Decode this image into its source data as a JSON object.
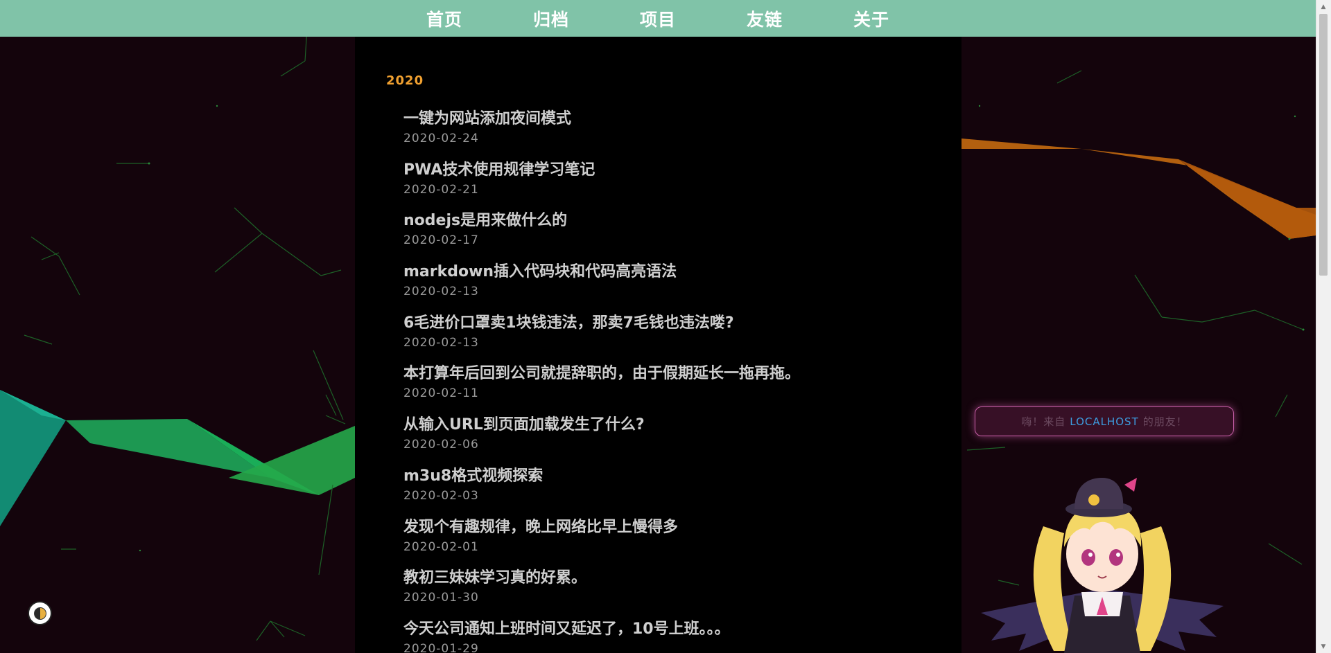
{
  "nav": {
    "items": [
      {
        "label": "首页"
      },
      {
        "label": "归档"
      },
      {
        "label": "项目"
      },
      {
        "label": "友链"
      },
      {
        "label": "关于"
      }
    ]
  },
  "archive": {
    "year": "2020",
    "posts": [
      {
        "title": "一键为网站添加夜间模式",
        "date": "2020-02-24"
      },
      {
        "title": "PWA技术使用规律学习笔记",
        "date": "2020-02-21"
      },
      {
        "title": "nodejs是用来做什么的",
        "date": "2020-02-17"
      },
      {
        "title": "markdown插入代码块和代码高亮语法",
        "date": "2020-02-13"
      },
      {
        "title": "6毛进价口罩卖1块钱违法，那卖7毛钱也违法喽?",
        "date": "2020-02-13"
      },
      {
        "title": "本打算年后回到公司就提辞职的，由于假期延长一拖再拖。",
        "date": "2020-02-11"
      },
      {
        "title": "从输入URL到页面加载发生了什么?",
        "date": "2020-02-06"
      },
      {
        "title": "m3u8格式视频探索",
        "date": "2020-02-03"
      },
      {
        "title": "发现个有趣规律，晚上网络比早上慢得多",
        "date": "2020-02-01"
      },
      {
        "title": "教初三妹妹学习真的好累。",
        "date": "2020-01-30"
      },
      {
        "title": "今天公司通知上班时间又延迟了，10号上班。。。",
        "date": "2020-01-29"
      }
    ]
  },
  "greeting": {
    "prefix": "嗨！来自",
    "host": "LOCALHOST",
    "suffix": "的朋友！"
  },
  "colors": {
    "nav_bg": "#80c3a8",
    "year": "#f0a030",
    "page_bg": "#14040c",
    "content_bg": "#000000"
  },
  "icons": {
    "theme_toggle": "day-night-toggle-icon",
    "mascot": "anime-mascot-character"
  }
}
